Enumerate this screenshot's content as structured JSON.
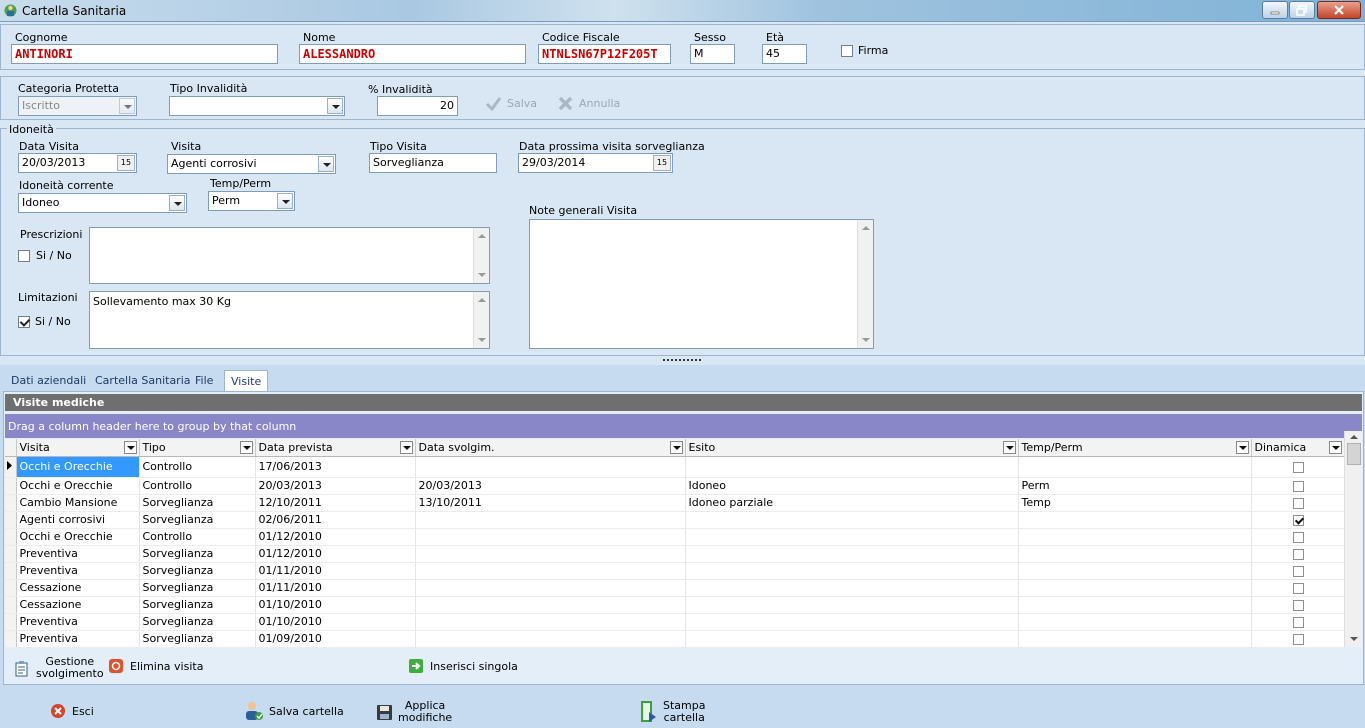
{
  "window": {
    "title": "Cartella Sanitaria"
  },
  "anagrafica": {
    "cognome_label": "Cognome",
    "cognome_value": "ANTINORI",
    "nome_label": "Nome",
    "nome_value": "ALESSANDRO",
    "cf_label": "Codice Fiscale",
    "cf_value": "NTNLSN67P12F205T",
    "sesso_label": "Sesso",
    "sesso_value": "M",
    "eta_label": "Età",
    "eta_value": "45",
    "firma_label": "Firma"
  },
  "invalidita": {
    "categoria_label": "Categoria Protetta",
    "categoria_value": "Iscritto",
    "tipo_label": "Tipo Invalidità",
    "tipo_value": "",
    "perc_label": "% Invalidità",
    "perc_value": "20",
    "salva_label": "Salva",
    "annulla_label": "Annulla"
  },
  "idoneita": {
    "group_title": "Idoneità",
    "data_visita_label": "Data Visita",
    "data_visita_value": "20/03/2013",
    "visita_label": "Visita",
    "visita_value": "Agenti corrosivi",
    "tipo_visita_label": "Tipo Visita",
    "tipo_visita_value": "Sorveglianza",
    "data_prossima_label": "Data prossima visita sorveglianza",
    "data_prossima_value": "29/03/2014",
    "idoneita_corrente_label": "Idoneità corrente",
    "idoneita_corrente_value": "Idoneo",
    "tempperm_label": "Temp/Perm",
    "tempperm_value": "Perm",
    "note_label": "Note generali Visita",
    "note_value": "",
    "prescrizioni_label": "Prescrizioni",
    "prescrizioni_sino": "Si / No",
    "prescrizioni_value": "",
    "limitazioni_label": "Limitazioni",
    "limitazioni_sino": "Si / No",
    "limitazioni_value": "Sollevamento max 30 Kg",
    "cal_glyph": "15"
  },
  "tabs": [
    {
      "label": "Dati aziendali"
    },
    {
      "label": "Cartella Sanitaria"
    },
    {
      "label": "File"
    },
    {
      "label": "Visite"
    }
  ],
  "grid": {
    "title": "Visite mediche",
    "group_hint": "Drag a column header here to group by that column",
    "columns": [
      "Visita",
      "Tipo",
      "Data prevista",
      "Data svolgim.",
      "Esito",
      "Temp/Perm",
      "Dinamica"
    ],
    "rows": [
      {
        "visita": "Occhi e Orecchie",
        "tipo": "Controllo",
        "prevista": "17/06/2013",
        "svolg": "",
        "esito": "",
        "tp": "",
        "din": false
      },
      {
        "visita": "Occhi e Orecchie",
        "tipo": "Controllo",
        "prevista": "20/03/2013",
        "svolg": "20/03/2013",
        "esito": "Idoneo",
        "tp": "Perm",
        "din": false
      },
      {
        "visita": "Cambio Mansione",
        "tipo": "Sorveglianza",
        "prevista": "12/10/2011",
        "svolg": "13/10/2011",
        "esito": "Idoneo parziale",
        "tp": "Temp",
        "din": false
      },
      {
        "visita": "Agenti corrosivi",
        "tipo": "Sorveglianza",
        "prevista": "02/06/2011",
        "svolg": "",
        "esito": "",
        "tp": "",
        "din": true
      },
      {
        "visita": "Occhi e Orecchie",
        "tipo": "Controllo",
        "prevista": "01/12/2010",
        "svolg": "",
        "esito": "",
        "tp": "",
        "din": false
      },
      {
        "visita": "Preventiva",
        "tipo": "Sorveglianza",
        "prevista": "01/12/2010",
        "svolg": "",
        "esito": "",
        "tp": "",
        "din": false
      },
      {
        "visita": "Preventiva",
        "tipo": "Sorveglianza",
        "prevista": "01/11/2010",
        "svolg": "",
        "esito": "",
        "tp": "",
        "din": false
      },
      {
        "visita": "Cessazione",
        "tipo": "Sorveglianza",
        "prevista": "01/11/2010",
        "svolg": "",
        "esito": "",
        "tp": "",
        "din": false
      },
      {
        "visita": "Cessazione",
        "tipo": "Sorveglianza",
        "prevista": "01/10/2010",
        "svolg": "",
        "esito": "",
        "tp": "",
        "din": false
      },
      {
        "visita": "Preventiva",
        "tipo": "Sorveglianza",
        "prevista": "01/10/2010",
        "svolg": "",
        "esito": "",
        "tp": "",
        "din": false
      },
      {
        "visita": "Preventiva",
        "tipo": "Sorveglianza",
        "prevista": "01/09/2010",
        "svolg": "",
        "esito": "",
        "tp": "",
        "din": false
      }
    ]
  },
  "grid_actions": {
    "gestione_line1": "Gestione",
    "gestione_line2": "svolgimento",
    "elimina": "Elimina visita",
    "inserisci": "Inserisci singola"
  },
  "footer": {
    "esci": "Esci",
    "salva_cartella": "Salva cartella",
    "applica_line1": "Applica",
    "applica_line2": "modifiche",
    "stampa_line1": "Stampa",
    "stampa_line2": "cartella"
  }
}
